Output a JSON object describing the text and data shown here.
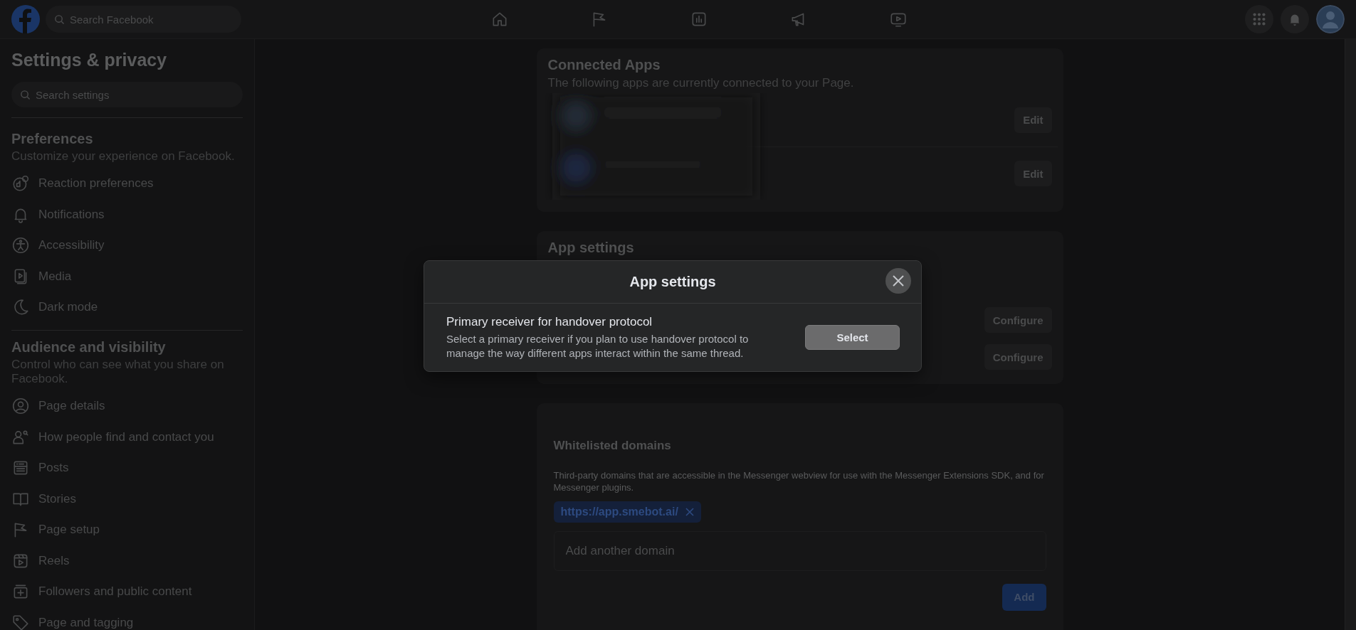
{
  "top_bar": {
    "search": {
      "placeholder": "Search Facebook"
    },
    "nav": [
      {
        "kind": "home"
      },
      {
        "kind": "flag"
      },
      {
        "kind": "chart"
      },
      {
        "kind": "megaphone"
      },
      {
        "kind": "video"
      }
    ],
    "actions": [
      {
        "kind": "grid"
      },
      {
        "kind": "bell"
      }
    ]
  },
  "sidebar": {
    "title": "Settings & privacy",
    "search": {
      "placeholder": "Search settings"
    },
    "sections": [
      {
        "title": "Preferences",
        "subtitle": "Customize your experience on Facebook.",
        "items": [
          {
            "label": "Reaction preferences",
            "kind": "reaction"
          },
          {
            "label": "Notifications",
            "kind": "bell"
          },
          {
            "label": "Accessibility",
            "kind": "accessibility"
          },
          {
            "label": "Media",
            "kind": "media"
          },
          {
            "label": "Dark mode",
            "kind": "moon"
          }
        ]
      },
      {
        "title": "Audience and visibility",
        "subtitle": "Control who can see what you share on Facebook.",
        "items": [
          {
            "label": "Page details",
            "kind": "person"
          },
          {
            "label": "How people find and contact you",
            "kind": "people"
          },
          {
            "label": "Posts",
            "kind": "posts"
          },
          {
            "label": "Stories",
            "kind": "book"
          },
          {
            "label": "Page setup",
            "kind": "flag"
          },
          {
            "label": "Reels",
            "kind": "reels"
          },
          {
            "label": "Followers and public content",
            "kind": "followers"
          },
          {
            "label": "Page and tagging",
            "kind": "tag"
          }
        ]
      }
    ]
  },
  "connected_apps": {
    "title": "Connected Apps",
    "subtitle": "The following apps are currently connected to your Page.",
    "apps": [
      {
        "action": "Edit"
      },
      {
        "action": "Edit"
      }
    ]
  },
  "app_settings": {
    "title": "App settings",
    "rows": [
      {
        "action": "Configure"
      },
      {
        "action": "Configure"
      }
    ]
  },
  "whitelisted_domains": {
    "title": "Whitelisted domains",
    "description": "Third-party domains that are accessible in the Messenger webview for use with the Messenger Extensions SDK, and for Messenger plugins.",
    "domains": [
      {
        "label": "https://app.smebot.ai/"
      }
    ],
    "input": {
      "placeholder": "Add another domain"
    },
    "button": "Add"
  },
  "modal": {
    "title": "App settings",
    "setting": {
      "title": "Primary receiver for handover protocol",
      "description": "Select a primary receiver if you plan to use handover protocol to manage the way different apps interact within the same thread.",
      "button": "Select"
    }
  }
}
